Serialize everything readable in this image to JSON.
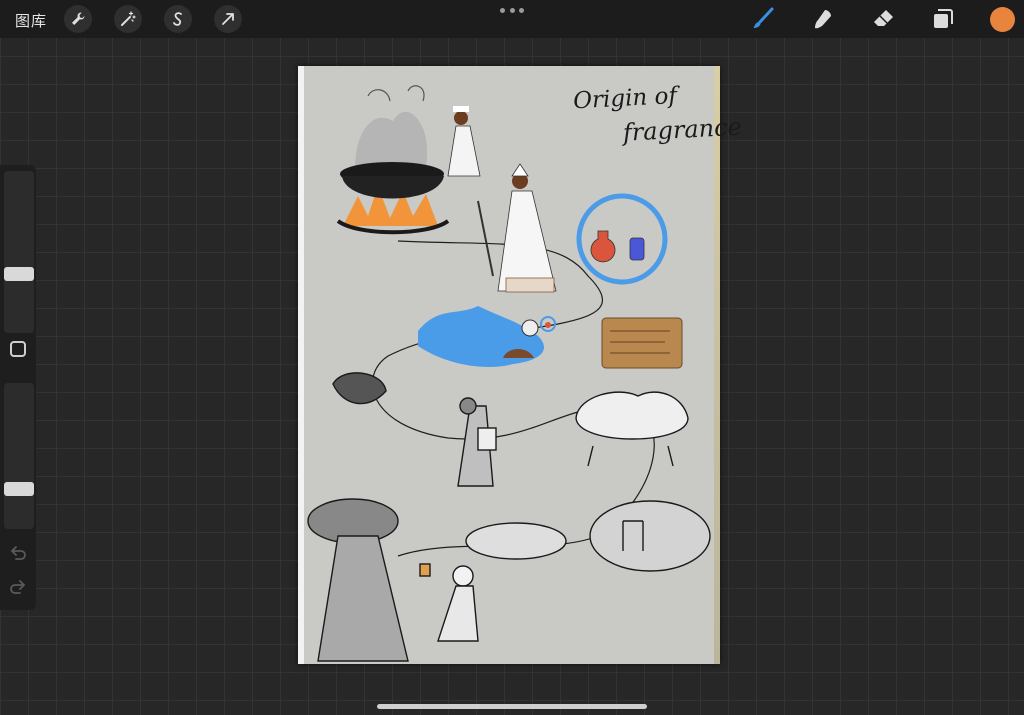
{
  "toolbar": {
    "gallery_label": "图库",
    "left_tools": [
      "wrench-icon",
      "magic-wand-icon",
      "selection-icon",
      "transform-arrow-icon"
    ],
    "right_tools": [
      "brush-icon",
      "smudge-icon",
      "eraser-icon",
      "layers-icon"
    ],
    "active_tool": "brush-icon",
    "current_color": "#e8843e",
    "accent_color": "#3a8ee6"
  },
  "sidebar": {
    "brush_size_level": 0.35,
    "opacity_level": 0.25,
    "modify_icon": "square-icon",
    "undo_icon": "undo-icon",
    "redo_icon": "redo-icon"
  },
  "canvas": {
    "title_line1": "Origin of",
    "title_line2": "fragrance",
    "paper_color": "#c9c9c6",
    "highlight_color": "#4a9be8",
    "fire_color": "#f2943a"
  }
}
